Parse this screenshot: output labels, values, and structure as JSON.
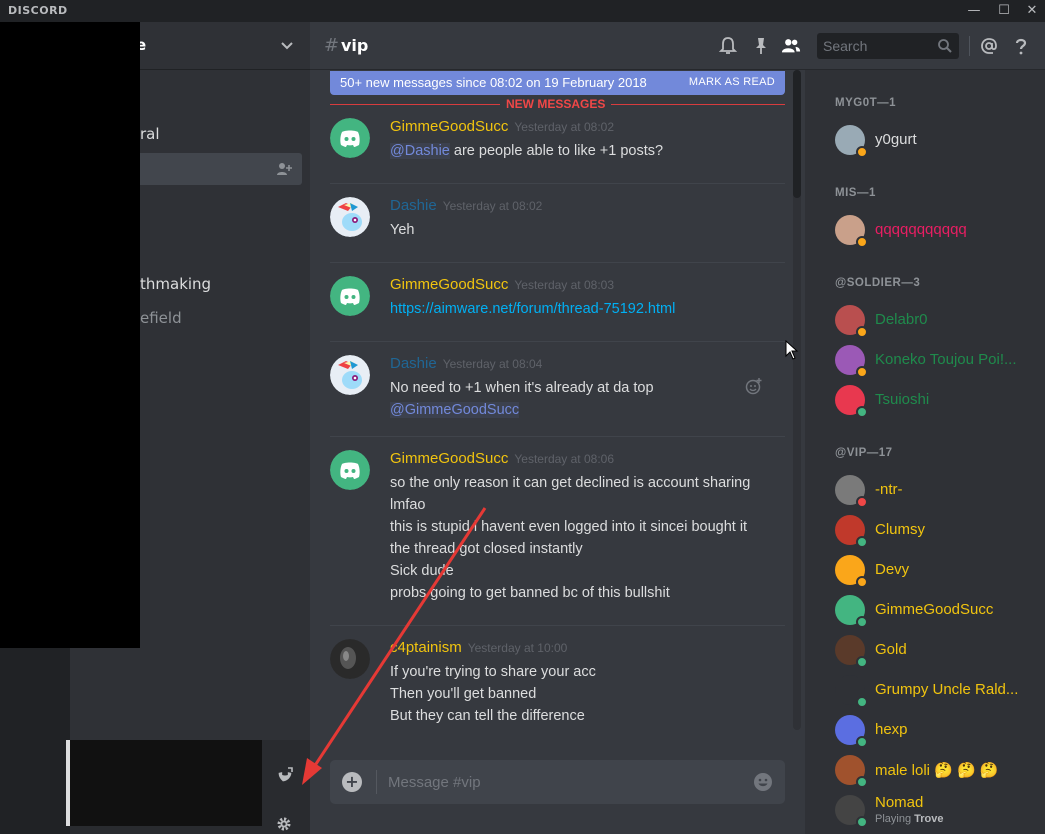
{
  "window": {
    "brand": "DISCORD",
    "minimize": "—",
    "maximize": "☐",
    "close": "✕"
  },
  "guild": {
    "name": "e"
  },
  "channels": [
    {
      "label": "ral",
      "active": false,
      "bright": true
    },
    {
      "label": "",
      "active": true,
      "bright": true
    },
    {
      "label": "thmaking",
      "active": false,
      "bright": true
    },
    {
      "label": "efield",
      "active": false,
      "bright": false
    }
  ],
  "chat": {
    "channel_name": "vip",
    "search_placeholder": "Search",
    "new_messages_bar": "50+ new messages since 08:02 on 19 February 2018",
    "mark_as_read": "MARK AS READ",
    "new_messages_divider": "NEW MESSAGES",
    "composer_placeholder": "Message #vip"
  },
  "messages": [
    {
      "author": "GimmeGoodSucc",
      "author_color": "#f1c40f",
      "timestamp": "Yesterday at 08:02",
      "avatar": "discord",
      "lines": [
        {
          "mention": "@Dashie",
          "text": " are people able to like +1 posts?"
        }
      ]
    },
    {
      "author": "Dashie",
      "author_color": "#206694",
      "timestamp": "Yesterday at 08:02",
      "avatar": "pony",
      "lines": [
        {
          "text": "Yeh"
        }
      ]
    },
    {
      "author": "GimmeGoodSucc",
      "author_color": "#f1c40f",
      "timestamp": "Yesterday at 08:03",
      "avatar": "discord",
      "lines": [
        {
          "link": "https://aimware.net/forum/thread-75192.html"
        }
      ]
    },
    {
      "author": "Dashie",
      "author_color": "#206694",
      "timestamp": "Yesterday at 08:04",
      "avatar": "pony",
      "lines": [
        {
          "text": "No need to +1 when it's already at da top"
        },
        {
          "mention": "@GimmeGoodSucc"
        }
      ]
    },
    {
      "author": "GimmeGoodSucc",
      "author_color": "#f1c40f",
      "timestamp": "Yesterday at 08:06",
      "avatar": "discord",
      "lines": [
        {
          "text": "so the only reason it can get declined is account sharing"
        },
        {
          "text": "lmfao"
        },
        {
          "text": "this is stupid i havent even logged into it sincei  bought it"
        },
        {
          "text": "the thread got closed instantly"
        },
        {
          "text": "Sick dude"
        },
        {
          "text": "probs going to get banned bc of this bullshit"
        }
      ]
    },
    {
      "author": "c4ptainism",
      "author_color": "#f1c40f",
      "timestamp": "Yesterday at 10:00",
      "avatar": "dark",
      "lines": [
        {
          "text": "If you're trying to share your acc"
        },
        {
          "text": "Then you'll get banned"
        },
        {
          "text": "But they can tell the difference"
        }
      ]
    }
  ],
  "member_groups": [
    {
      "title": "MYG0T—1",
      "members": [
        {
          "name": "y0gurt",
          "color": "#dcddde",
          "status": "#faa61a",
          "avatar_color": "#99aab5"
        }
      ]
    },
    {
      "title": "MIS—1",
      "members": [
        {
          "name": "qqqqqqqqqqq",
          "color": "#e91e63",
          "status": "#faa61a",
          "avatar_color": "#c9a08a"
        }
      ]
    },
    {
      "title": "@SOLDIER—3",
      "members": [
        {
          "name": "Delabr0",
          "color": "#1f8b4c",
          "status": "#faa61a",
          "avatar_color": "#b94f4f"
        },
        {
          "name": "Koneko Toujou Poi!...",
          "color": "#1f8b4c",
          "status": "#faa61a",
          "avatar_color": "#9b59b6"
        },
        {
          "name": "Tsuioshi",
          "color": "#1f8b4c",
          "status": "#43b581",
          "avatar_color": "#e8384f"
        }
      ]
    },
    {
      "title": "@VIP—17",
      "members": [
        {
          "name": "-ntr-",
          "color": "#f1c40f",
          "status": "#f04747",
          "avatar_color": "#7a7a7a"
        },
        {
          "name": "Clumsy",
          "color": "#f1c40f",
          "status": "#43b581",
          "avatar_color": "#c0392b"
        },
        {
          "name": "Devy",
          "color": "#f1c40f",
          "status": "#faa61a",
          "avatar_color": "#faa61a"
        },
        {
          "name": "GimmeGoodSucc",
          "color": "#f1c40f",
          "status": "#43b581",
          "avatar_color": "#43b581"
        },
        {
          "name": "Gold",
          "color": "#f1c40f",
          "status": "#43b581",
          "avatar_color": "#5a3a2a"
        },
        {
          "name": "Grumpy Uncle Rald...",
          "color": "#f1c40f",
          "status": "#43b581",
          "avatar_color": "#2f3136"
        },
        {
          "name": "hexp",
          "color": "#f1c40f",
          "status": "#43b581",
          "avatar_color": "#5b6ee1"
        },
        {
          "name": "male loli 🤔 🤔 🤔",
          "color": "#f1c40f",
          "status": "#43b581",
          "avatar_color": "#a0522d"
        },
        {
          "name": "Nomad",
          "color": "#f1c40f",
          "status": "#43b581",
          "avatar_color": "#444",
          "playing": "Playing",
          "game": "Trove"
        }
      ]
    }
  ]
}
